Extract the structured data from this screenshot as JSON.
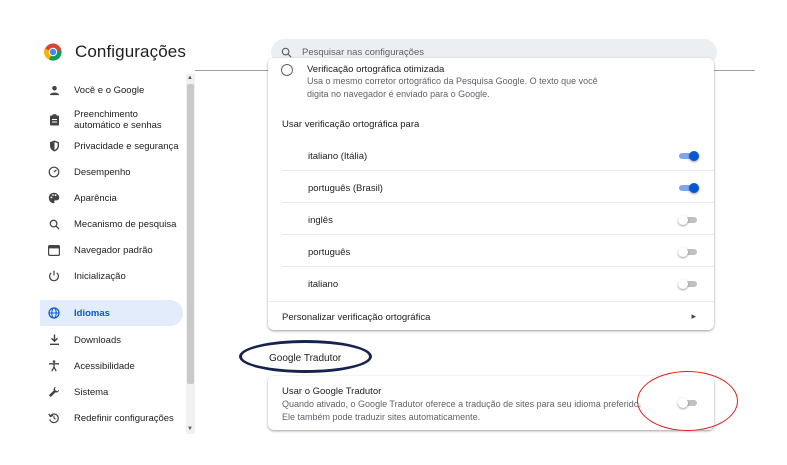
{
  "header": {
    "title": "Configurações",
    "search_placeholder": "Pesquisar nas configurações"
  },
  "sidebar": {
    "items": [
      {
        "label": "Você e o Google",
        "icon": "person-icon"
      },
      {
        "label": "Preenchimento automático e senhas",
        "icon": "clipboard-icon"
      },
      {
        "label": "Privacidade e segurança",
        "icon": "shield-icon"
      },
      {
        "label": "Desempenho",
        "icon": "speedometer-icon"
      },
      {
        "label": "Aparência",
        "icon": "palette-icon"
      },
      {
        "label": "Mecanismo de pesquisa",
        "icon": "search-icon"
      },
      {
        "label": "Navegador padrão",
        "icon": "browser-icon"
      },
      {
        "label": "Inicialização",
        "icon": "power-icon"
      },
      {
        "label": "Idiomas",
        "icon": "globe-icon",
        "active": true
      },
      {
        "label": "Downloads",
        "icon": "download-icon"
      },
      {
        "label": "Acessibilidade",
        "icon": "accessibility-icon"
      },
      {
        "label": "Sistema",
        "icon": "wrench-icon"
      },
      {
        "label": "Redefinir configurações",
        "icon": "reset-icon"
      }
    ]
  },
  "spellcheck": {
    "cut_title": "Verificação ortográfica otimizada",
    "description": "Usa o mesmo corretor ortográfico da Pesquisa Google. O texto que você digita no navegador é enviado para o Google.",
    "section_label": "Usar verificação ortográfica para",
    "languages": [
      {
        "label": "italiano (Itália)",
        "enabled": true
      },
      {
        "label": "português (Brasil)",
        "enabled": true
      },
      {
        "label": "inglês",
        "enabled": false
      },
      {
        "label": "português",
        "enabled": false
      },
      {
        "label": "italiano",
        "enabled": false
      }
    ],
    "customize_label": "Personalizar verificação ortográfica"
  },
  "translate": {
    "heading": "Google Tradutor",
    "title": "Usar o Google Tradutor",
    "description": "Quando ativado, o Google Tradutor oferece a tradução de sites para seu idioma preferido. Ele também pode traduzir sites automaticamente.",
    "enabled": false
  },
  "colors": {
    "accent": "#0b57d0",
    "annotation_dark": "#16234f",
    "annotation_red": "#e21d1d"
  }
}
